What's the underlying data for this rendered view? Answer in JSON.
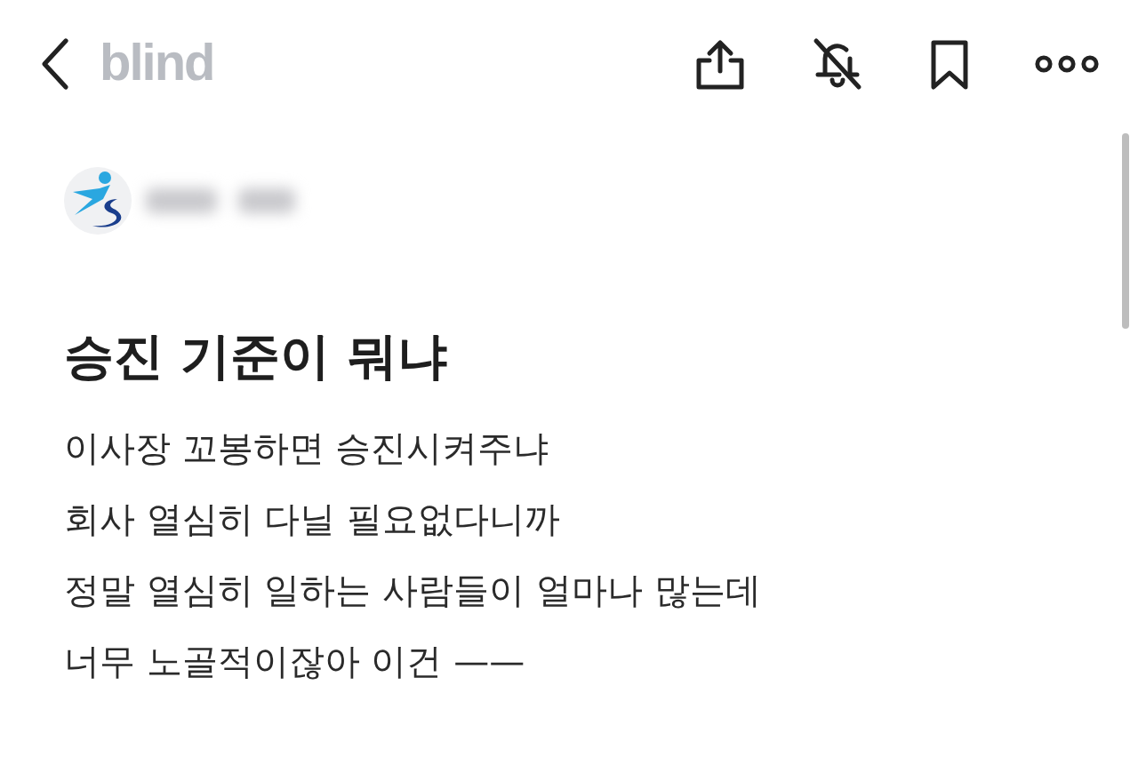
{
  "header": {
    "logo": "blind"
  },
  "post": {
    "title": "승진 기준이 뭐냐",
    "body_lines": [
      "이사장 꼬봉하면 승진시켜주냐",
      "회사 열심히 다닐 필요없다니까",
      "정말 열심히 일하는 사람들이 얼마나 많는데",
      "너무 노골적이잖아 이건 ——"
    ]
  }
}
